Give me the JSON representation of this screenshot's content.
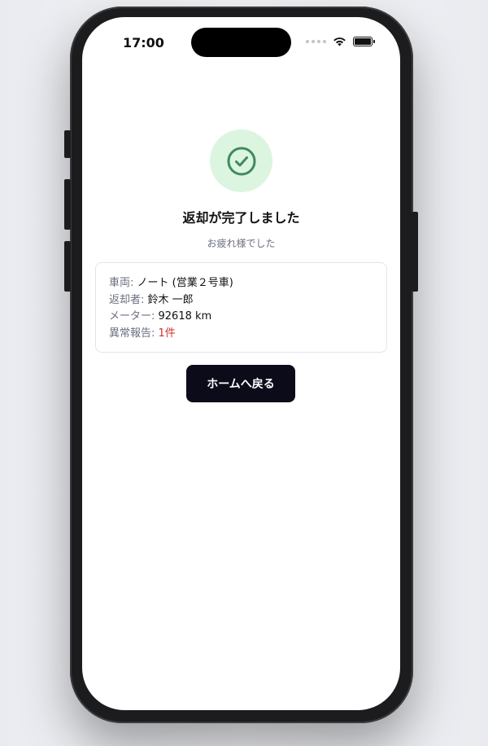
{
  "status_bar": {
    "time": "17:00"
  },
  "complete": {
    "title": "返却が完了しました",
    "subtitle": "お疲れ様でした"
  },
  "details": [
    {
      "label": "車両: ",
      "value": "ノート (営業２号車)"
    },
    {
      "label": "返却者: ",
      "value": "鈴木 一郎"
    },
    {
      "label": "メーター: ",
      "value": "92618 km"
    },
    {
      "label": "異常報告: ",
      "value": "1件"
    }
  ],
  "home_button_label": "ホームへ戻る",
  "colors": {
    "success_bg": "#dcf5e0",
    "success_icon": "#3f8a5c",
    "alert": "#d32f2f",
    "primary_button": "#0b0b1a"
  }
}
